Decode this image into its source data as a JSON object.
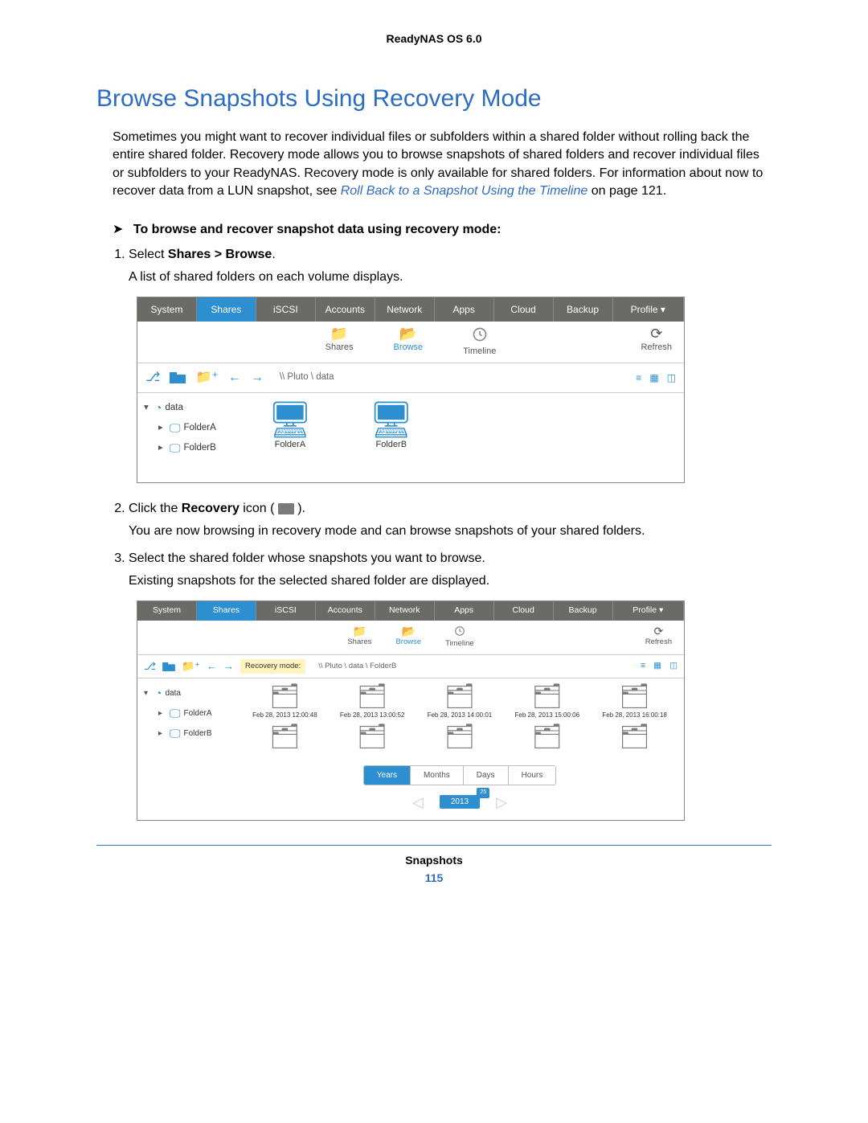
{
  "doc_header": "ReadyNAS OS 6.0",
  "h1": "Browse Snapshots Using Recovery Mode",
  "intro_text": "Sometimes you might want to recover individual files or subfolders within a shared folder without rolling back the entire shared folder. Recovery mode allows you to browse snapshots of shared folders and recover individual files or subfolders to your ReadyNAS. Recovery mode is only available for shared folders. For information about now to recover data from a LUN snapshot, see ",
  "intro_link": "Roll Back to a Snapshot Using the Timeline",
  "intro_tail": " on page 121.",
  "task_heading": "To browse and recover snapshot data using recovery mode:",
  "step1_a": "Select ",
  "step1_b": "Shares > Browse",
  "step1_c": ".",
  "step1_sub": "A list of shared folders on each volume displays.",
  "step2_a": "Click the ",
  "step2_b": "Recovery",
  "step2_c": " icon ( ",
  "step2_d": " ).",
  "step2_sub": "You are now browsing in recovery mode and can browse snapshots of your shared folders.",
  "step3": "Select the shared folder whose snapshots you want to browse.",
  "step3_sub": "Existing snapshots for the selected shared folder are displayed.",
  "tabs": [
    "System",
    "Shares",
    "iSCSI",
    "Accounts",
    "Network",
    "Apps",
    "Cloud",
    "Backup"
  ],
  "profile": "Profile ▾",
  "sub": {
    "shares": "Shares",
    "browse": "Browse",
    "timeline": "Timeline",
    "refresh": "Refresh"
  },
  "ss1": {
    "path": "\\\\ Pluto \\ data",
    "tree": {
      "root": "data",
      "a": "FolderA",
      "b": "FolderB"
    },
    "folders": [
      "FolderA",
      "FolderB"
    ]
  },
  "ss2": {
    "recovery_label": "Recovery mode:",
    "path": "\\\\ Pluto \\ data \\ FolderB",
    "tree": {
      "root": "data",
      "a": "FolderA",
      "b": "FolderB"
    },
    "snaps": [
      "Feb 28, 2013 12:00:48",
      "Feb 28, 2013 13:00:52",
      "Feb 28, 2013 14:00:01",
      "Feb 28, 2013 15:00:06",
      "Feb 28, 2013 16:00:18",
      "",
      "",
      "",
      "",
      ""
    ],
    "tl_tabs": [
      "Years",
      "Months",
      "Days",
      "Hours"
    ],
    "year": "2013",
    "year_badge": "25"
  },
  "footer_section": "Snapshots",
  "footer_page": "115"
}
